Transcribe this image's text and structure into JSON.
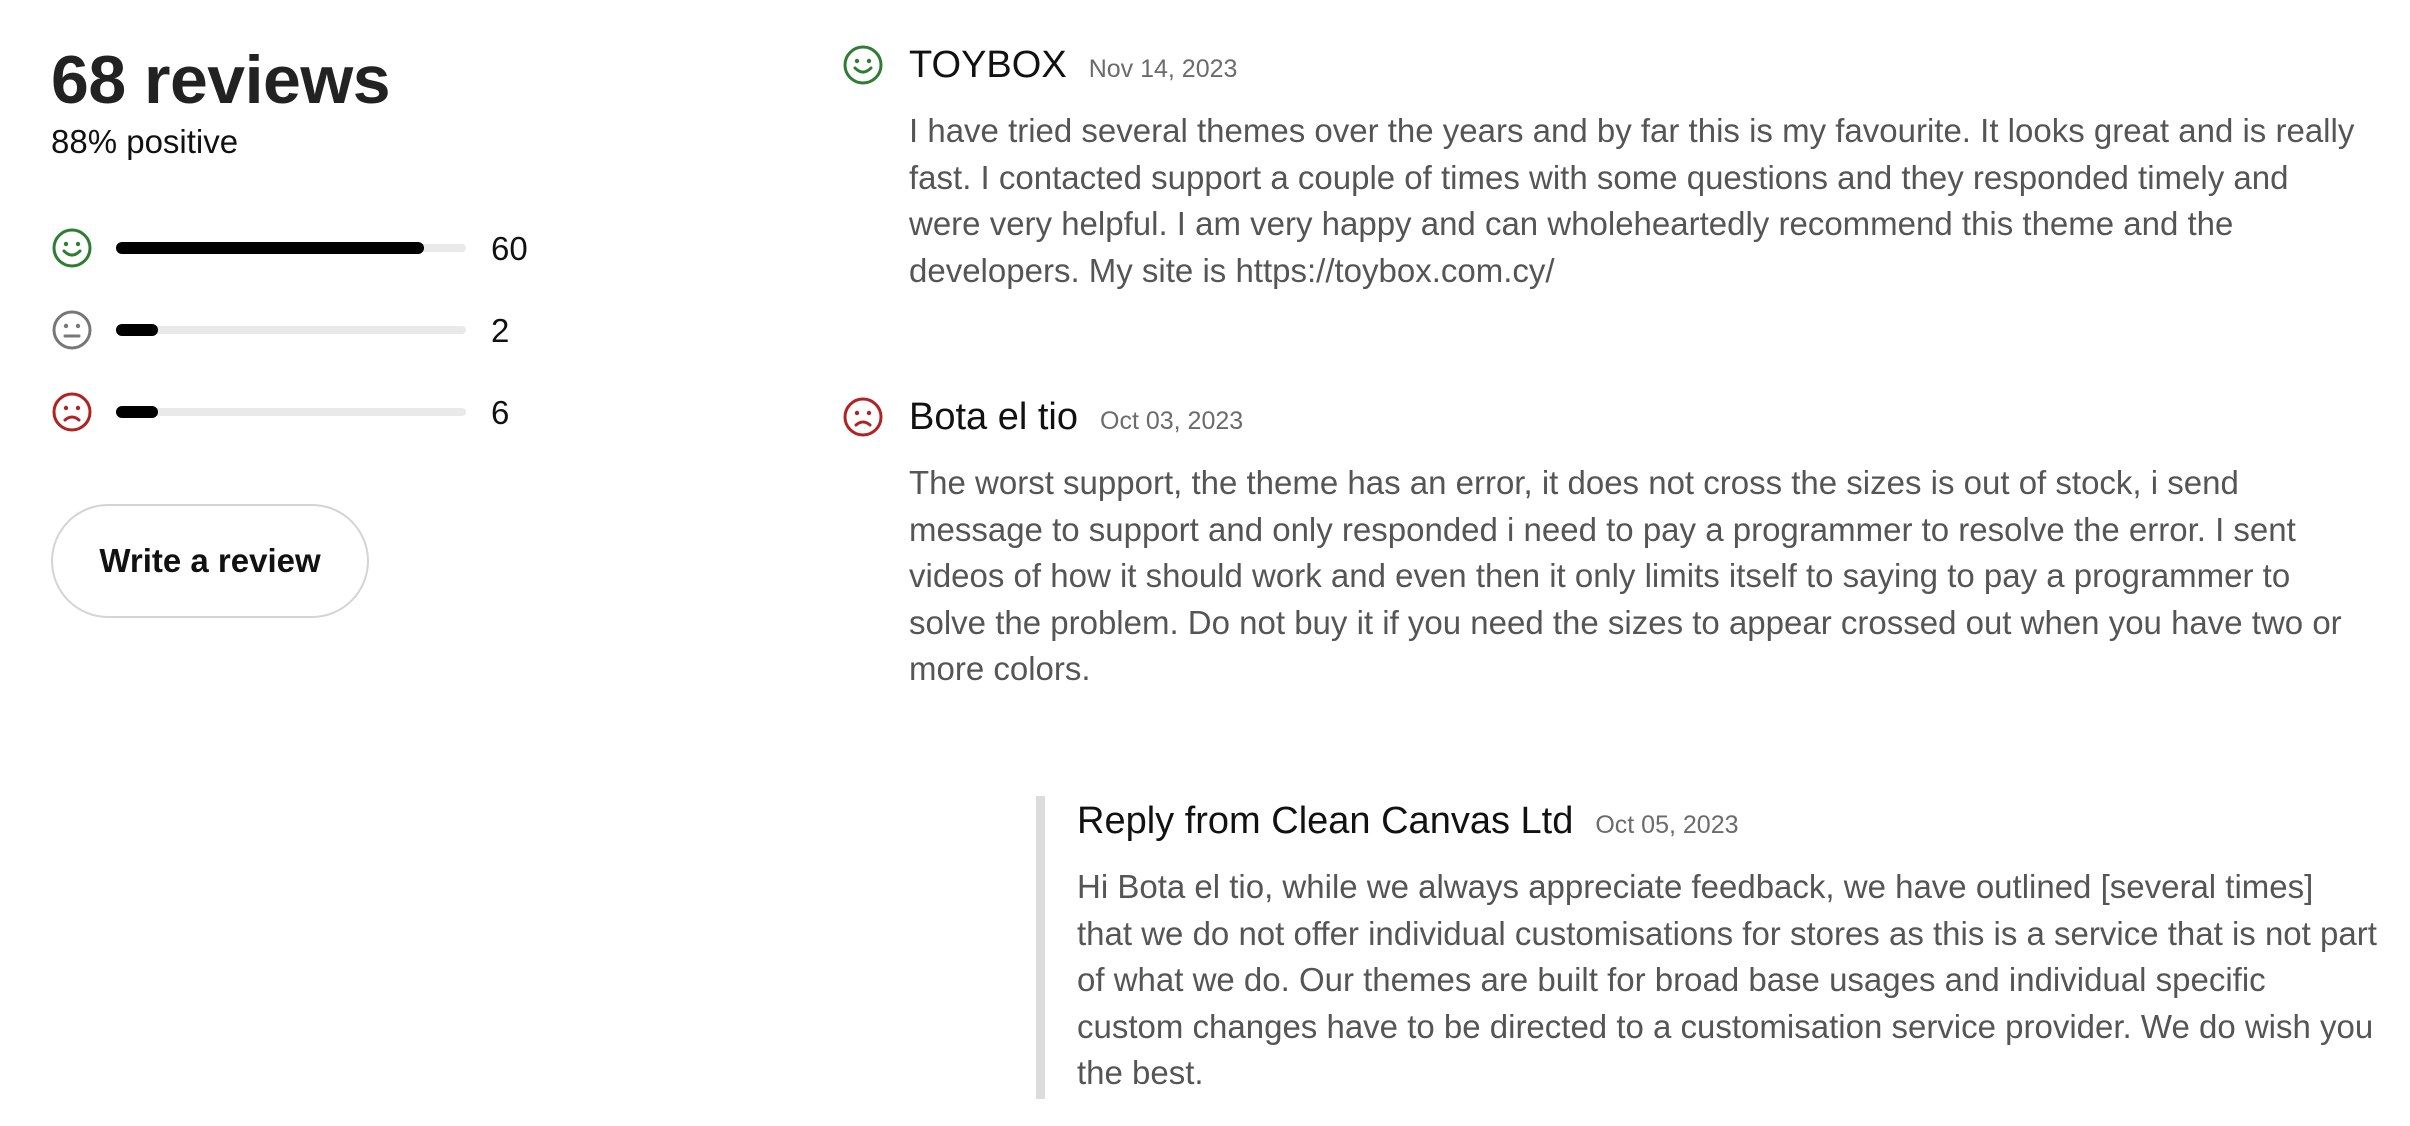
{
  "summary": {
    "total": "68 reviews",
    "positive": "88% positive",
    "rows": [
      {
        "type": "positive",
        "count": "60",
        "fraction": 0.88,
        "color": "#2e7d32"
      },
      {
        "type": "neutral",
        "count": "2",
        "fraction": 0.03,
        "color": "#777777"
      },
      {
        "type": "negative",
        "count": "6",
        "fraction": 0.09,
        "color": "#b22222"
      }
    ],
    "write_label": "Write a review"
  },
  "reviews": [
    {
      "sentiment": "positive",
      "author": "TOYBOX",
      "date": "Nov 14, 2023",
      "body": "I have tried several themes over the years and by far this is my favourite. It looks great and is really fast. I contacted support a couple of times with some questions and they responded timely and were very helpful. I am very happy and can wholeheartedly recommend this theme and the developers. My site is https://toybox.com.cy/"
    },
    {
      "sentiment": "negative",
      "author": "Bota el tio",
      "date": "Oct 03, 2023",
      "body": "The worst support, the theme has an error, it does not cross the sizes is out of stock, i send message to support and only responded i need to pay a programmer to resolve the error. I sent videos of how it should work and even then it only limits itself to saying to pay a programmer to solve the problem. Do not buy it if you need the sizes to appear crossed out when you have two or more colors.",
      "reply": {
        "author": "Reply from Clean Canvas Ltd",
        "date": "Oct 05, 2023",
        "body": "Hi Bota el tio, while we always appreciate feedback, we have outlined [several times] that we do not offer individual customisations for stores as this is a service that is not part of what we do. Our themes are built for broad base usages and individual specific custom changes have to be directed to a customisation service provider. We do wish you the best."
      }
    }
  ]
}
